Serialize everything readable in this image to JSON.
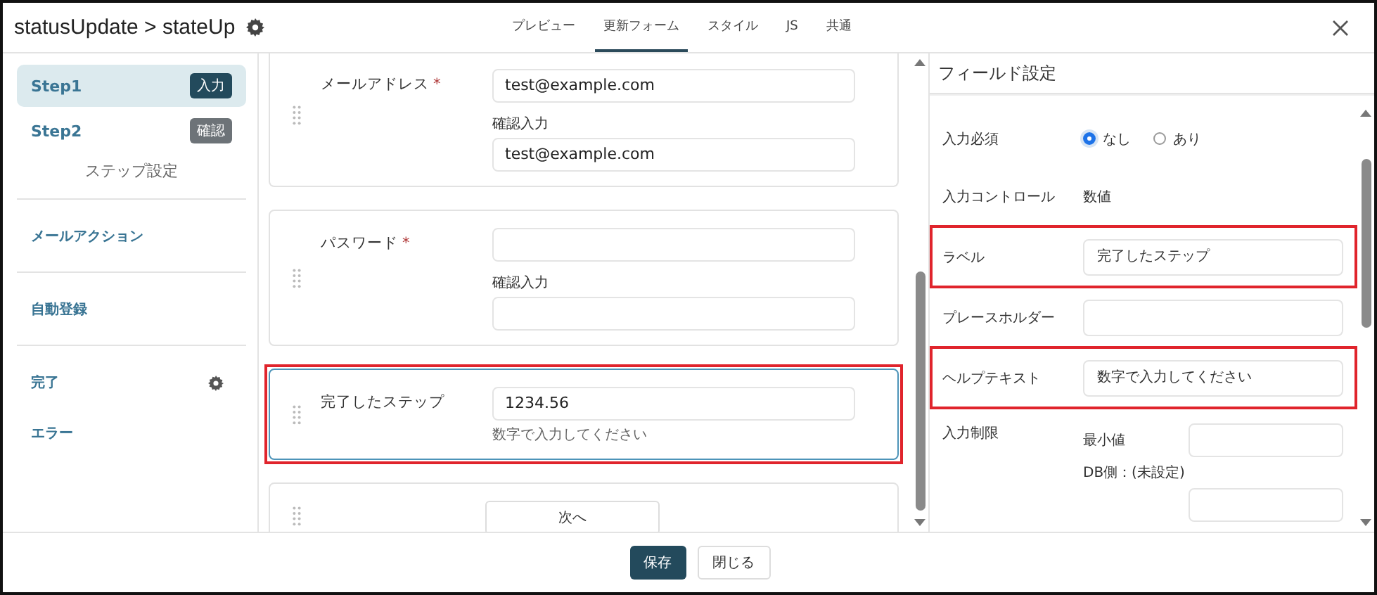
{
  "window": {
    "title": "statusUpdate > stateUp"
  },
  "tabs": [
    {
      "label": "プレビュー",
      "selected": false
    },
    {
      "label": "更新フォーム",
      "selected": true
    },
    {
      "label": "スタイル",
      "selected": false
    },
    {
      "label": "JS",
      "selected": false
    },
    {
      "label": "共通",
      "selected": false
    }
  ],
  "sidebar": {
    "steps": [
      {
        "label": "Step1",
        "badge": "入力",
        "selected": true
      },
      {
        "label": "Step2",
        "badge": "確認",
        "selected": false
      }
    ],
    "step_settings": "ステップ設定",
    "items": [
      {
        "label": "メールアクション",
        "kind": "section"
      },
      {
        "label": "自動登録",
        "kind": "section"
      },
      {
        "label": "完了",
        "kind": "gear"
      },
      {
        "label": "エラー",
        "kind": "plain"
      }
    ]
  },
  "form": {
    "fields": [
      {
        "kind": "input",
        "label": "メールアドレス",
        "required_mark": "*",
        "value": "test@example.com",
        "confirm_label": "確認入力",
        "confirm_value": "test@example.com",
        "highlighted": false
      },
      {
        "kind": "input",
        "label": "パスワード",
        "required_mark": "*",
        "confirm_label": "確認入力",
        "highlighted": false
      },
      {
        "kind": "input",
        "label": "完了したステップ",
        "value": "1234.56",
        "help": "数字で入力してください",
        "highlighted": true
      },
      {
        "kind": "button",
        "label": "次へ",
        "highlighted": false
      }
    ]
  },
  "field_settings": {
    "title": "フィールド設定",
    "rows": [
      {
        "kind": "radio",
        "label": "入力必須",
        "options": [
          {
            "label": "なし",
            "selected": true
          },
          {
            "label": "あり",
            "selected": false
          }
        ],
        "highlighted": false
      },
      {
        "kind": "text",
        "label": "入力コントロール",
        "value": "数値",
        "highlighted": false
      },
      {
        "kind": "input",
        "label": "ラベル",
        "value": "完了したステップ",
        "highlighted": true
      },
      {
        "kind": "input",
        "label": "プレースホルダー",
        "highlighted": false
      },
      {
        "kind": "input",
        "label": "ヘルプテキスト",
        "value": "数字で入力してください",
        "highlighted": true
      },
      {
        "kind": "limit",
        "label": "入力制限",
        "min_label": "最小値",
        "db_note": "DB側：(未設定)",
        "highlighted": false
      }
    ]
  },
  "footer": {
    "buttons": [
      {
        "label": "保存",
        "kind": "primary"
      },
      {
        "label": "閉じる",
        "kind": "secondary"
      }
    ]
  }
}
